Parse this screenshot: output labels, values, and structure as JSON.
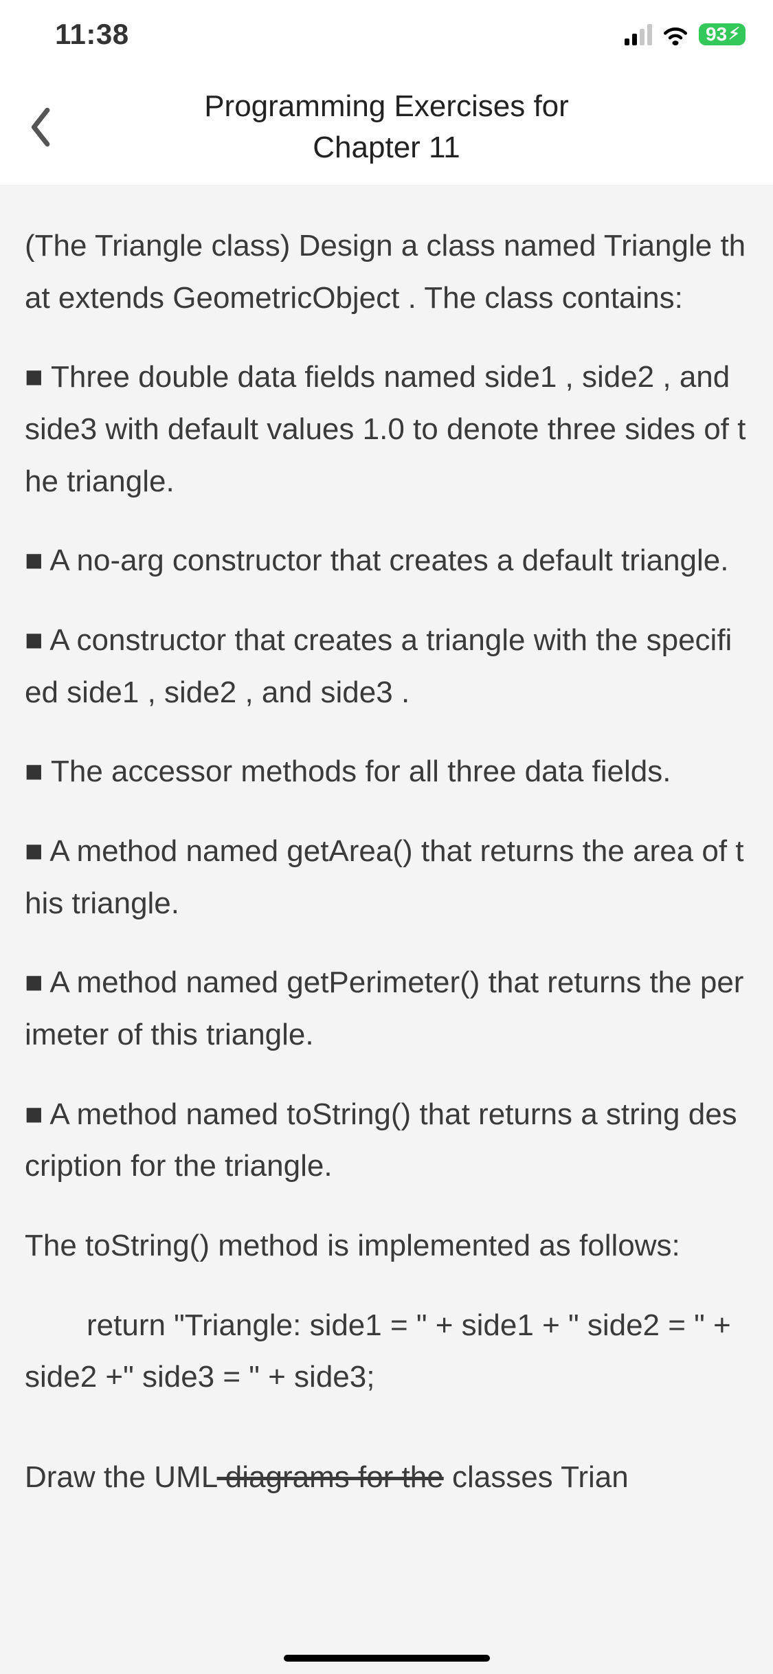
{
  "status": {
    "time": "11:38",
    "battery": "93"
  },
  "nav": {
    "title_line1": "Programming Exercises for",
    "title_line2": "Chapter 11"
  },
  "body": {
    "intro": "(The Triangle class) Design a class named Triangle that extends GeometricObject . The class contains:",
    "bullets": [
      "Three double data fields named side1 , side2 , and side3 with default values 1.0 to denote three sides of the triangle.",
      "A no-arg constructor that creates a default triangle.",
      "A constructor that creates a triangle with the specified side1 , side2 , and side3 .",
      "The accessor methods for all three data fields.",
      "A method named getArea() that returns the area of this triangle.",
      "A method named getPerimeter() that returns the perimeter of this triangle.",
      "A method named toString() that returns a string description for the triangle."
    ],
    "impl_intro": "The toString() method is implemented as follows:",
    "code_line": "return \"Triangle: side1 = \" + side1 + \" side2 = \" + side2 +\" side3 = \" + side3;",
    "final_pre": "Draw the UML",
    "final_struck": " diagrams for the",
    "final_post": " classes Trian"
  }
}
